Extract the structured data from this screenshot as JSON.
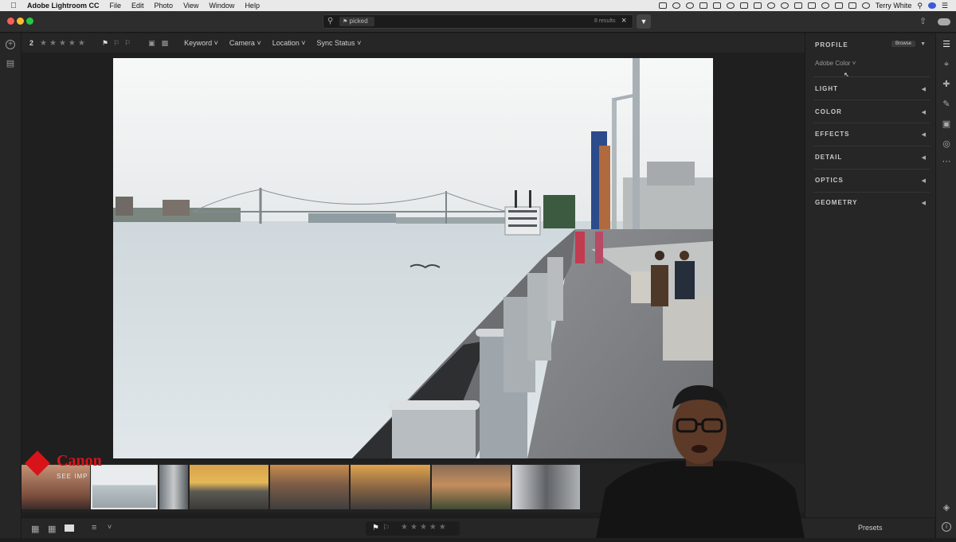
{
  "menubar": {
    "app": "Adobe Lightroom CC",
    "items": [
      "File",
      "Edit",
      "Photo",
      "View",
      "Window",
      "Help"
    ],
    "user": "Terry White"
  },
  "search": {
    "chip": "picked",
    "results": "8 results"
  },
  "toolbar": {
    "count": "2",
    "rating_stars": 5,
    "filters": [
      "Keyword",
      "Camera",
      "Location",
      "Sync Status"
    ]
  },
  "panel": {
    "title": "PROFILE",
    "browse": "Browse",
    "profile_value": "Adobe Color",
    "sections": [
      "LIGHT",
      "COLOR",
      "EFFECTS",
      "DETAIL",
      "OPTICS",
      "GEOMETRY"
    ],
    "presets": "Presets"
  },
  "watermark": {
    "brand": "Canon",
    "tagline": "SEE IMP"
  },
  "colors": {
    "canon_red": "#d7141a",
    "panel_bg": "#262626",
    "canvas_bg": "#1f1f1f"
  }
}
